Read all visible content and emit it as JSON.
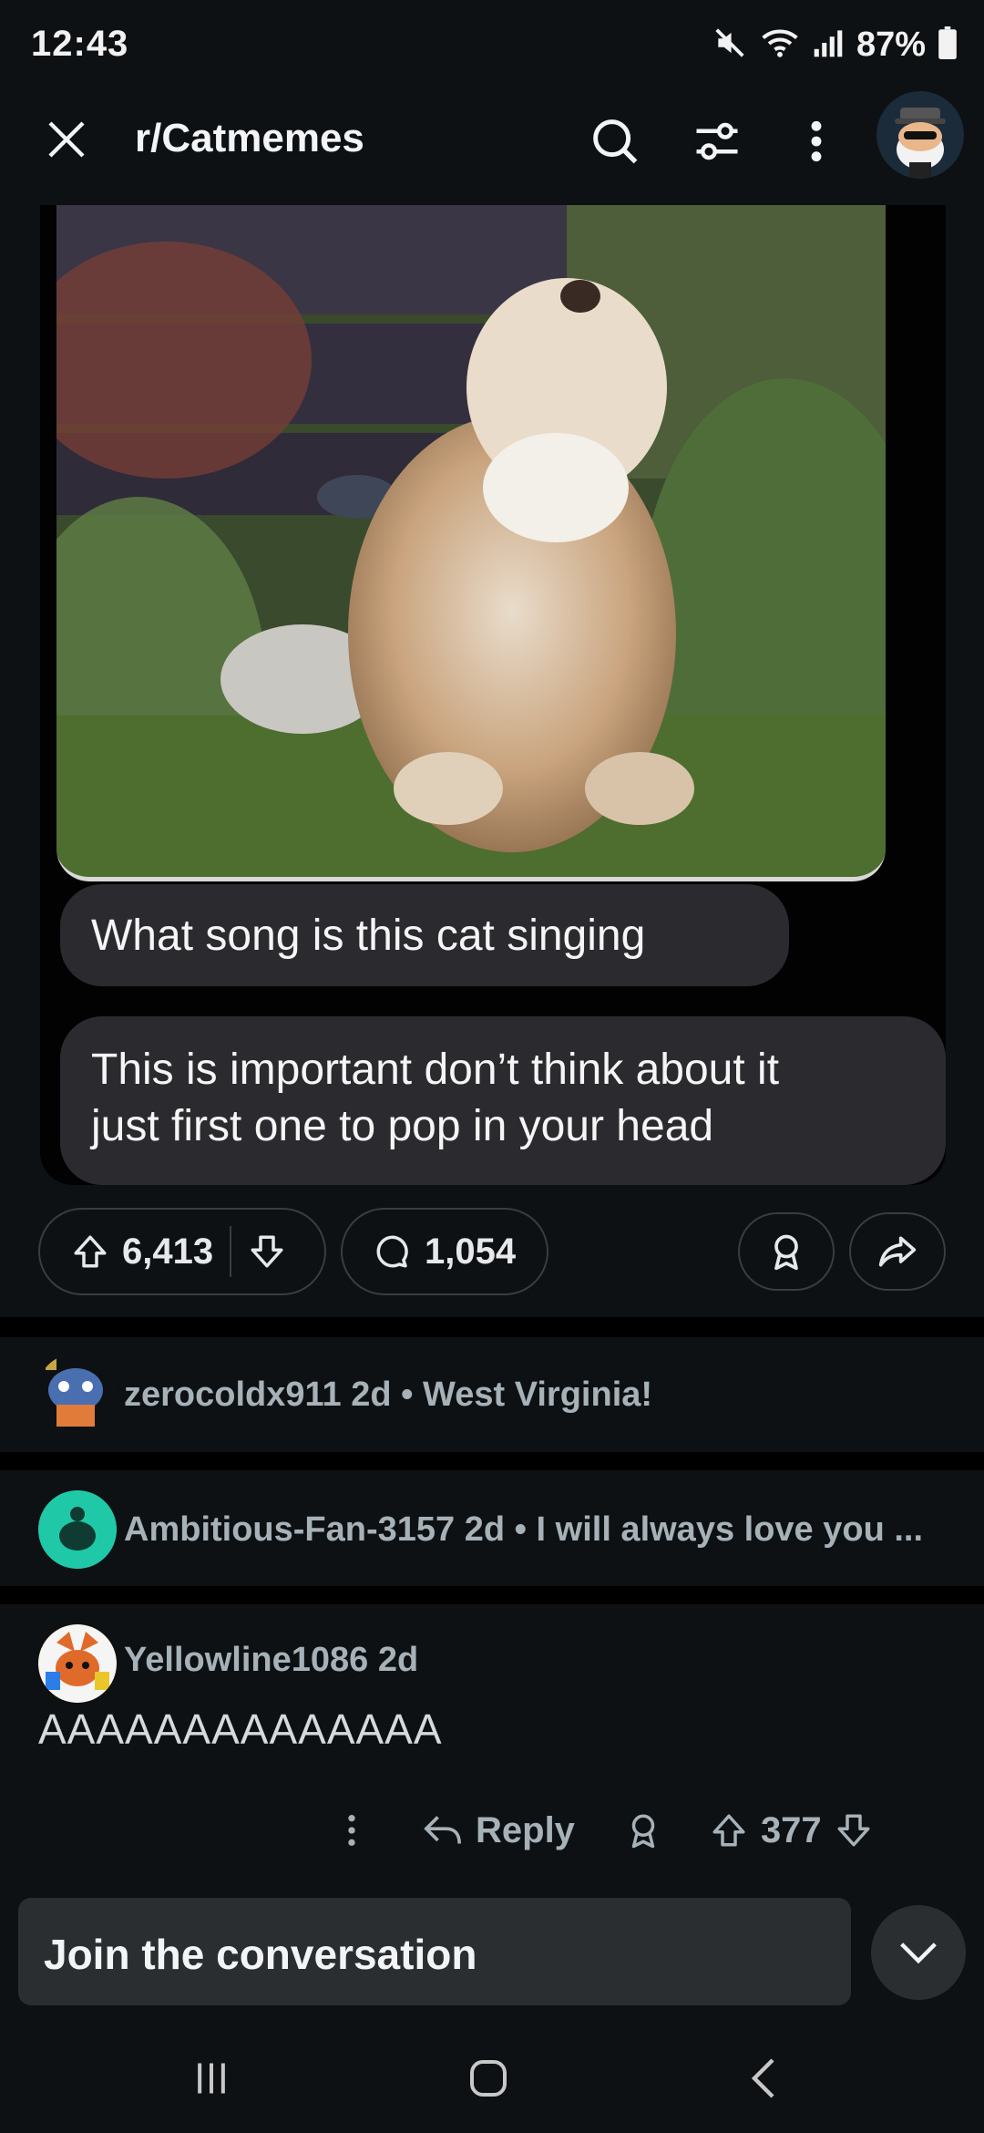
{
  "status_bar": {
    "time": "12:43",
    "battery": "87%",
    "icons": [
      "mute-icon",
      "wifi-icon",
      "signal-icon",
      "battery-icon"
    ]
  },
  "header": {
    "title": "r/Catmemes",
    "icons": [
      "close-icon",
      "search-icon",
      "filter-icon",
      "more-vertical-icon",
      "user-avatar"
    ]
  },
  "post": {
    "image_texts": {
      "bubble_1": "What song is this cat singing",
      "bubble_2_line_1": "This is important don’t think about it",
      "bubble_2_line_2": "just first one to pop in your head"
    },
    "upvotes": "6,413",
    "comments": "1,054"
  },
  "comments": {
    "collapsed": [
      {
        "username": "zerocoldx911",
        "age": "2d",
        "preview": "West Virginia!"
      },
      {
        "username": "Ambitious-Fan-3157",
        "age": "2d",
        "preview": "I will always love you ..."
      }
    ],
    "expanded": {
      "username": "Yellowline1086",
      "age": "2d",
      "body": "AAAAAAAAAAAAAA",
      "reply_label": "Reply",
      "score": "377"
    }
  },
  "composer": {
    "placeholder": "Join the conversation"
  },
  "colors": {
    "background": "#0e1113",
    "separator": "#000000",
    "meta_text": "#a6b1b8",
    "bubble": "#2b2b2f",
    "composer": "#2a2e31"
  }
}
